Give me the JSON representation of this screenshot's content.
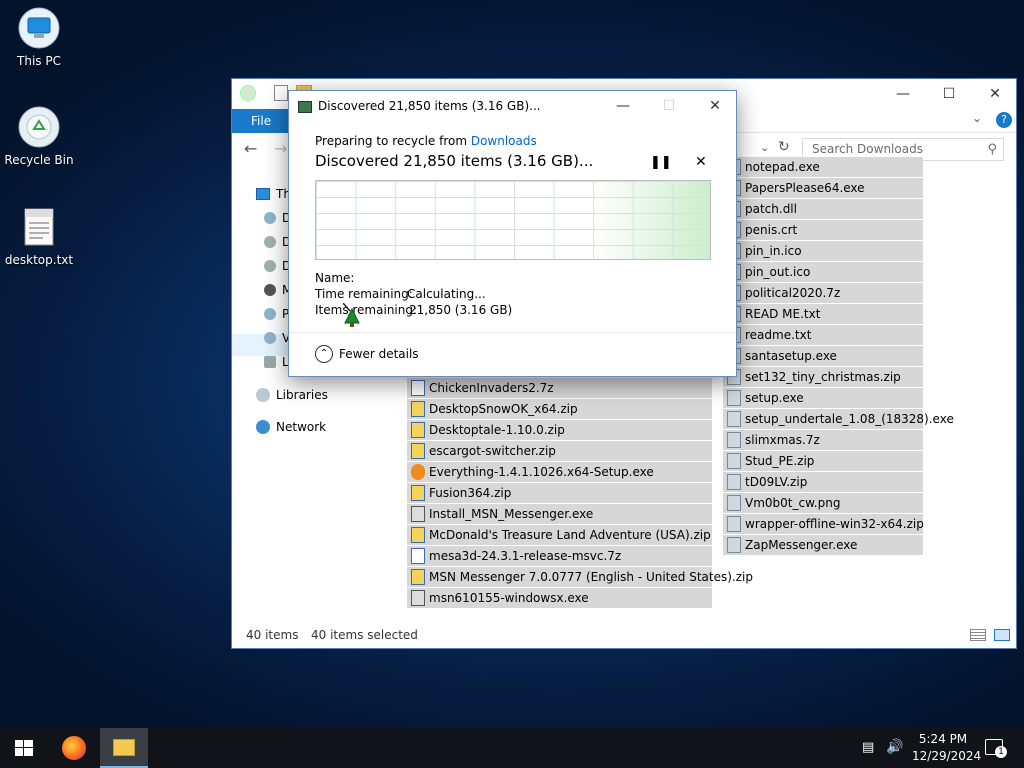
{
  "desktop": {
    "icons": [
      {
        "label": "This PC",
        "icon": "computer-icon"
      },
      {
        "label": "Recycle Bin",
        "icon": "recycle-bin-icon"
      },
      {
        "label": "desktop.txt",
        "icon": "text-file-icon"
      }
    ]
  },
  "explorer": {
    "ribbon": {
      "file_tab": "File"
    },
    "title_partial": "Downloads",
    "search": {
      "placeholder": "Search Downloads"
    },
    "nav": {
      "this_pc": "Th",
      "sub_items": [
        "D",
        "D",
        "D",
        "M",
        "P",
        "V",
        "L"
      ],
      "libraries": "Libraries",
      "network": "Network"
    },
    "files_left": [
      "ChickenInvaders2.7z",
      "DesktopSnowOK_x64.zip",
      "Desktoptale-1.10.0.zip",
      "escargot-switcher.zip",
      "Everything-1.4.1.1026.x64-Setup.exe",
      "Fusion364.zip",
      "Install_MSN_Messenger.exe",
      "McDonald's Treasure Land Adventure (USA).zip",
      "mesa3d-24.3.1-release-msvc.7z",
      "MSN Messenger 7.0.0777 (English - United States).zip",
      "msn610155-windowsx.exe"
    ],
    "files_right": [
      "notepad.exe",
      "PapersPlease64.exe",
      "patch.dll",
      "penis.crt",
      "pin_in.ico",
      "pin_out.ico",
      "political2020.7z",
      "READ ME.txt",
      "readme.txt",
      "santasetup.exe",
      "set132_tiny_christmas.zip",
      "setup.exe",
      "setup_undertale_1.08_(18328).exe",
      "slimxmas.7z",
      "Stud_PE.zip",
      "tD09LV.zip",
      "Vm0b0t_cw.png",
      "wrapper-offline-win32-x64.zip",
      "ZapMessenger.exe"
    ],
    "status": {
      "count": "40 items",
      "selected": "40 items selected"
    }
  },
  "dialog": {
    "title": "Discovered 21,850 items (3.16 GB)...",
    "preparing_prefix": "Preparing to recycle from ",
    "source_link": "Downloads",
    "heading": "Discovered 21,850 items (3.16 GB)...",
    "name_label": "Name:",
    "time_label": "Time remaining:",
    "time_value": "Calculating...",
    "items_label": "Items remaining:",
    "items_value": "21,850 (3.16 GB)",
    "fewer_details": "Fewer details"
  },
  "taskbar": {
    "time": "5:24 PM",
    "date": "12/29/2024",
    "notification_count": "1"
  },
  "colors": {
    "accent": "#1979ca",
    "selection": "#d7d7d7",
    "link": "#0066cc"
  }
}
